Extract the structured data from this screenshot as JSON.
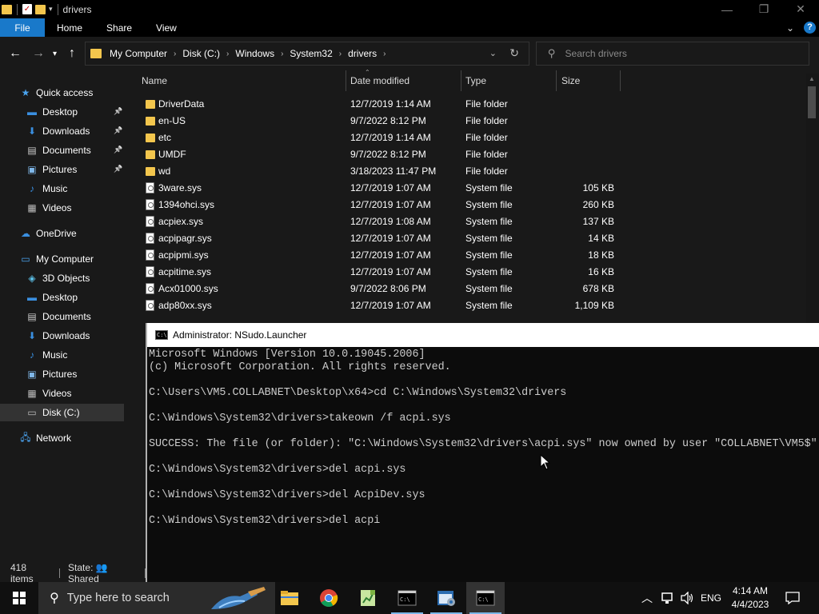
{
  "window": {
    "title": "drivers",
    "controls": {
      "minimize": "—",
      "maximize": "❐",
      "close": "✕"
    }
  },
  "ribbon": {
    "tabs": [
      "File",
      "Home",
      "Share",
      "View"
    ]
  },
  "address": {
    "crumbs": [
      "My Computer",
      "Disk (C:)",
      "Windows",
      "System32",
      "drivers"
    ],
    "search_placeholder": "Search drivers"
  },
  "nav": {
    "quick_access": "Quick access",
    "quick_items": [
      {
        "label": "Desktop",
        "icon": "desktop-icon",
        "pinned": true
      },
      {
        "label": "Downloads",
        "icon": "downloads-icon",
        "pinned": true
      },
      {
        "label": "Documents",
        "icon": "documents-icon",
        "pinned": true
      },
      {
        "label": "Pictures",
        "icon": "pictures-icon",
        "pinned": true
      },
      {
        "label": "Music",
        "icon": "music-icon",
        "pinned": false
      },
      {
        "label": "Videos",
        "icon": "videos-icon",
        "pinned": false
      }
    ],
    "onedrive": "OneDrive",
    "my_computer": "My Computer",
    "pc_items": [
      {
        "label": "3D Objects",
        "icon": "3d-objects-icon"
      },
      {
        "label": "Desktop",
        "icon": "desktop-icon"
      },
      {
        "label": "Documents",
        "icon": "documents-icon"
      },
      {
        "label": "Downloads",
        "icon": "downloads-icon"
      },
      {
        "label": "Music",
        "icon": "music-icon"
      },
      {
        "label": "Pictures",
        "icon": "pictures-icon"
      },
      {
        "label": "Videos",
        "icon": "videos-icon"
      },
      {
        "label": "Disk (C:)",
        "icon": "disk-icon"
      }
    ],
    "network": "Network"
  },
  "files": {
    "columns": [
      "Name",
      "Date modified",
      "Type",
      "Size"
    ],
    "rows": [
      {
        "name": "DriverData",
        "date": "12/7/2019 1:14 AM",
        "type": "File folder",
        "size": "",
        "kind": "folder"
      },
      {
        "name": "en-US",
        "date": "9/7/2022 8:12 PM",
        "type": "File folder",
        "size": "",
        "kind": "folder"
      },
      {
        "name": "etc",
        "date": "12/7/2019 1:14 AM",
        "type": "File folder",
        "size": "",
        "kind": "folder"
      },
      {
        "name": "UMDF",
        "date": "9/7/2022 8:12 PM",
        "type": "File folder",
        "size": "",
        "kind": "folder"
      },
      {
        "name": "wd",
        "date": "3/18/2023 11:47 PM",
        "type": "File folder",
        "size": "",
        "kind": "folder"
      },
      {
        "name": "3ware.sys",
        "date": "12/7/2019 1:07 AM",
        "type": "System file",
        "size": "105 KB",
        "kind": "sys"
      },
      {
        "name": "1394ohci.sys",
        "date": "12/7/2019 1:07 AM",
        "type": "System file",
        "size": "260 KB",
        "kind": "sys"
      },
      {
        "name": "acpiex.sys",
        "date": "12/7/2019 1:08 AM",
        "type": "System file",
        "size": "137 KB",
        "kind": "sys"
      },
      {
        "name": "acpipagr.sys",
        "date": "12/7/2019 1:07 AM",
        "type": "System file",
        "size": "14 KB",
        "kind": "sys"
      },
      {
        "name": "acpipmi.sys",
        "date": "12/7/2019 1:07 AM",
        "type": "System file",
        "size": "18 KB",
        "kind": "sys"
      },
      {
        "name": "acpitime.sys",
        "date": "12/7/2019 1:07 AM",
        "type": "System file",
        "size": "16 KB",
        "kind": "sys"
      },
      {
        "name": "Acx01000.sys",
        "date": "9/7/2022 8:06 PM",
        "type": "System file",
        "size": "678 KB",
        "kind": "sys"
      },
      {
        "name": "adp80xx.sys",
        "date": "12/7/2019 1:07 AM",
        "type": "System file",
        "size": "1,109 KB",
        "kind": "sys"
      }
    ]
  },
  "status": {
    "items": "418 items",
    "state": "State: 👥 Shared"
  },
  "console": {
    "title": "Administrator: NSudo.Launcher",
    "lines": [
      "Microsoft Windows [Version 10.0.19045.2006]",
      "(c) Microsoft Corporation. All rights reserved.",
      "",
      "C:\\Users\\VM5.COLLABNET\\Desktop\\x64>cd C:\\Windows\\System32\\drivers",
      "",
      "C:\\Windows\\System32\\drivers>takeown /f acpi.sys",
      "",
      "SUCCESS: The file (or folder): \"C:\\Windows\\System32\\drivers\\acpi.sys\" now owned by user \"COLLABNET\\VM5$\".",
      "",
      "C:\\Windows\\System32\\drivers>del acpi.sys",
      "",
      "C:\\Windows\\System32\\drivers>del AcpiDev.sys",
      "",
      "C:\\Windows\\System32\\drivers>del acpi"
    ]
  },
  "taskbar": {
    "search_placeholder": "Type here to search",
    "language": "ENG",
    "time": "4:14 AM",
    "date": "4/4/2023"
  }
}
